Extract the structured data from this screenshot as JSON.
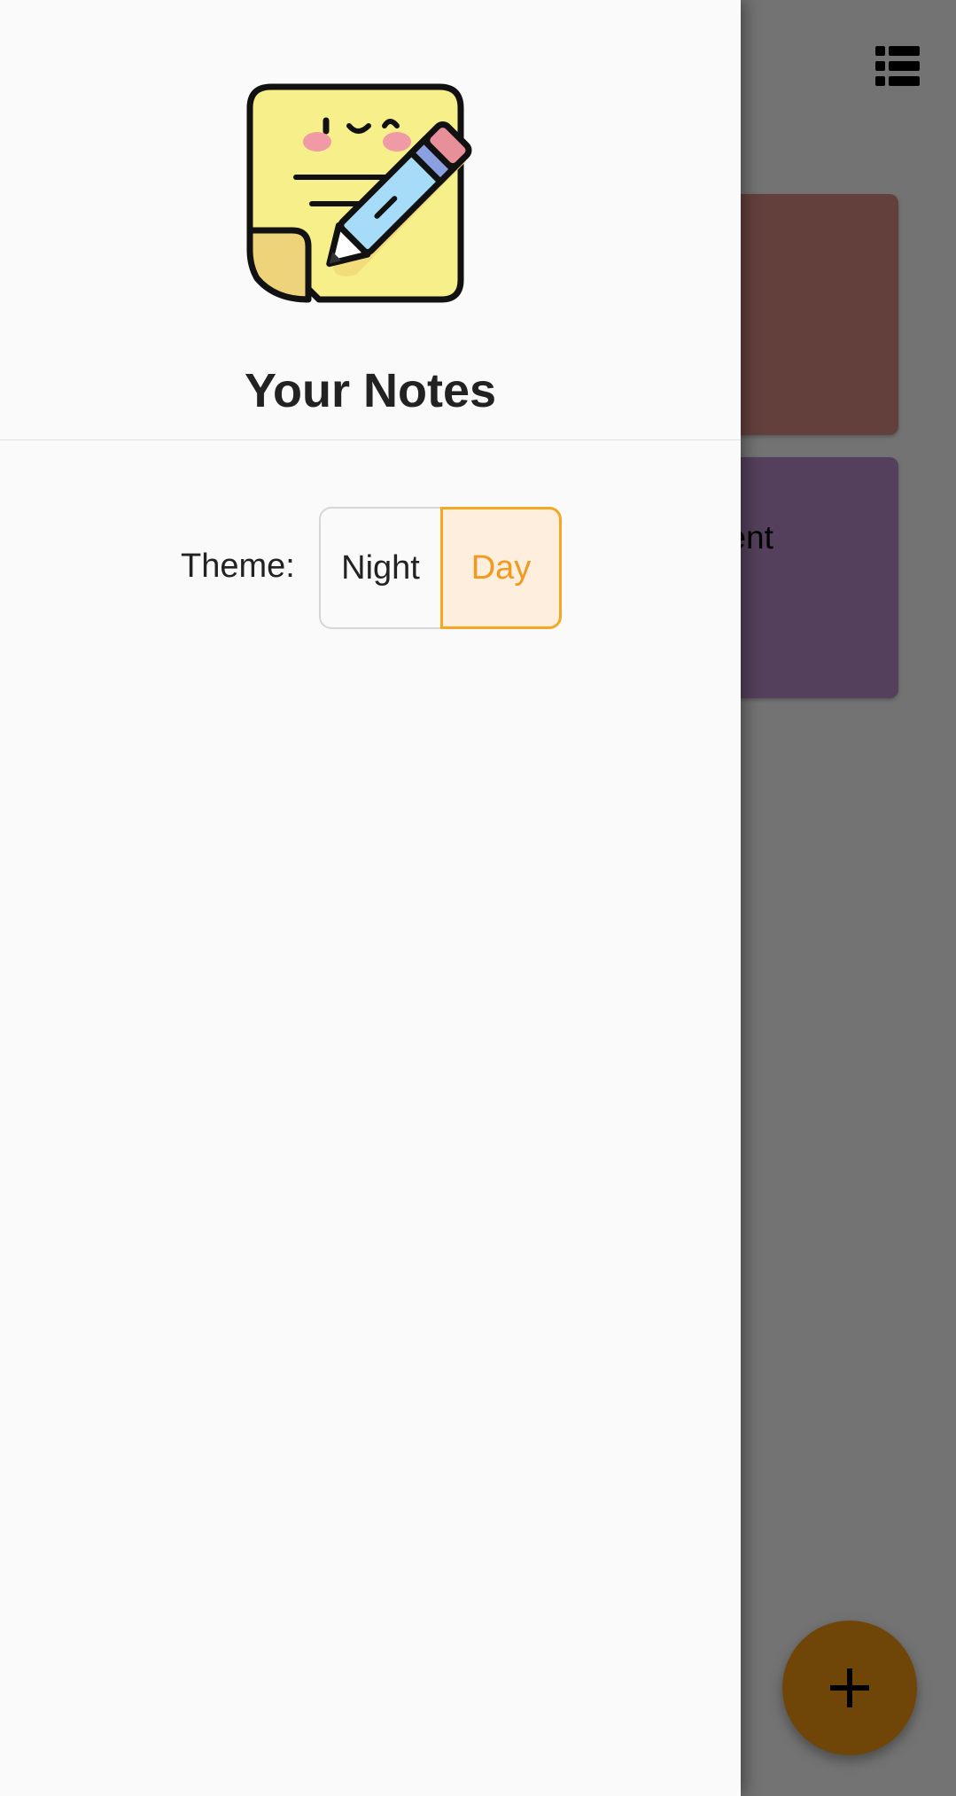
{
  "app": {
    "notes": [
      {
        "text": ""
      },
      {
        "text": "ontent"
      }
    ],
    "fab_label": "+"
  },
  "drawer": {
    "title": "Your Notes",
    "theme_label": "Theme:",
    "theme_options": [
      "Night",
      "Day"
    ],
    "selected_theme": "Day"
  },
  "colors": {
    "accent": "#f29813",
    "note_red": "#d98b85",
    "note_purple": "#b88bc9",
    "logo_yellow": "#f7ef8a",
    "pencil_blue": "#a6dcf7",
    "eraser_pink": "#e8909a"
  }
}
